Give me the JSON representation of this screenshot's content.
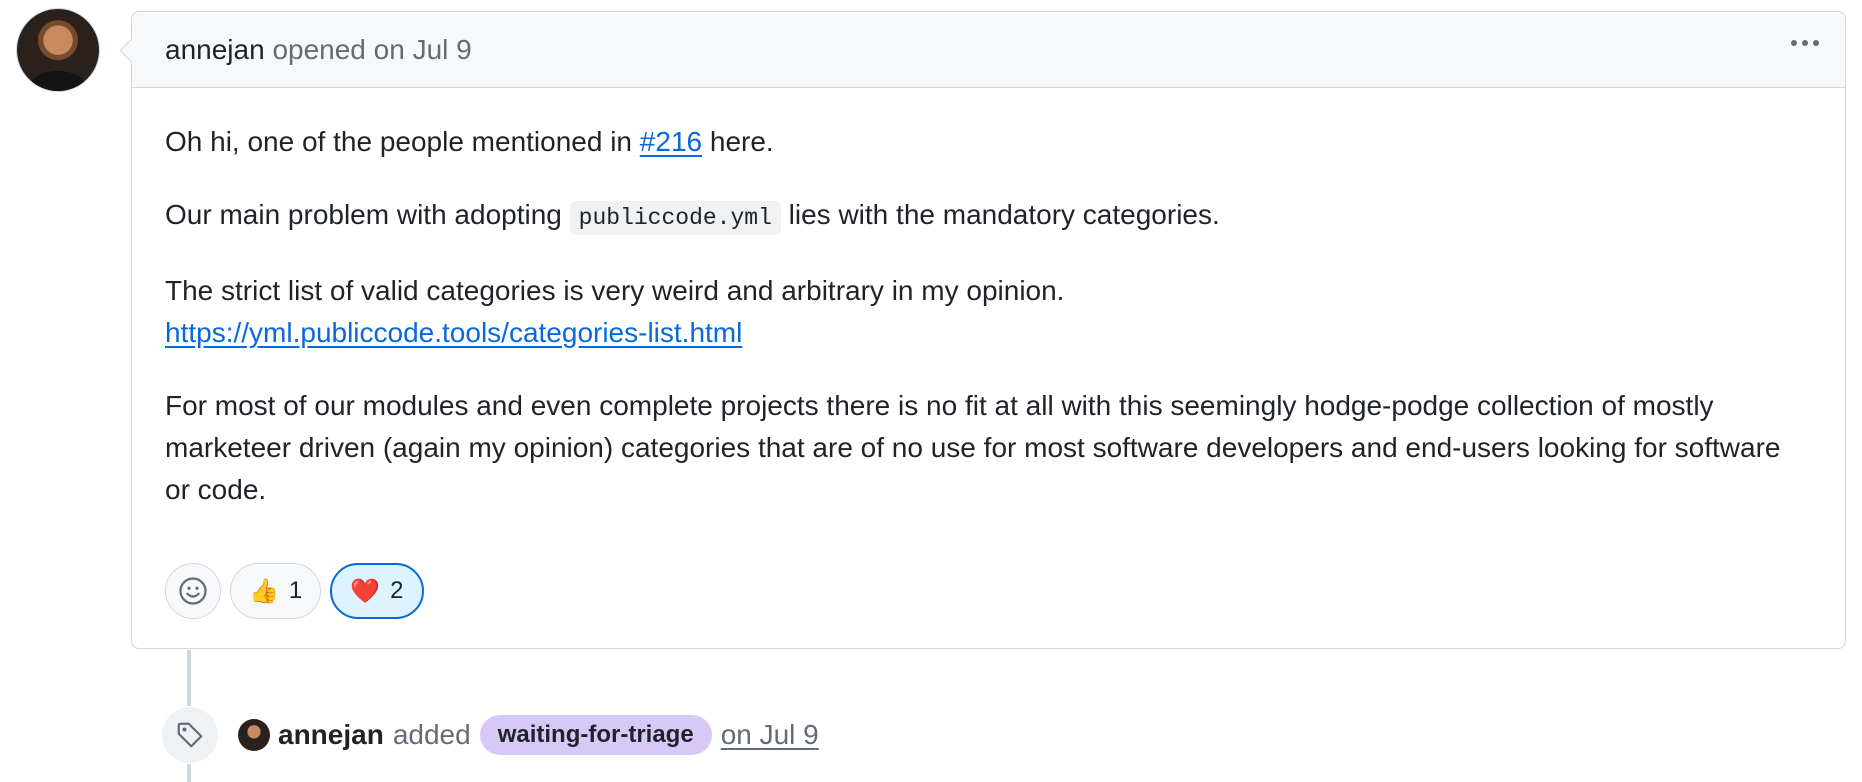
{
  "comment": {
    "author": "annejan",
    "action_text": "opened on Jul 9",
    "body": {
      "p1_before": "Oh hi, one of the people mentioned in ",
      "p1_link": "#216",
      "p1_after": " here.",
      "p2_before": "Our main problem with adopting ",
      "p2_code": "publiccode.yml",
      "p2_after": " lies with the mandatory categories.",
      "p3_text": "The strict list of valid categories is very weird and arbitrary in my opinion.",
      "p3_link": "https://yml.publiccode.tools/categories-list.html",
      "p4_text": "For most of our modules and even complete projects there is no fit at all with this seemingly hodge-podge collection of mostly marketeer driven (again my opinion) categories that are of no use for most software developers and end-users looking for software or code."
    },
    "reactions": [
      {
        "emoji": "👍",
        "count": "1",
        "active": false
      },
      {
        "emoji": "❤️",
        "count": "2",
        "active": true
      }
    ]
  },
  "event": {
    "actor": "annejan",
    "verb": "added",
    "label": "waiting-for-triage",
    "label_color": "#d8c8f8",
    "date": "on Jul 9"
  },
  "icons": [
    "avatar",
    "kebab-icon",
    "smiley-icon",
    "tag-icon"
  ],
  "colors": {
    "link": "#0969da",
    "muted": "#636c76",
    "border": "#d0d7de",
    "active_reaction_bg": "#ddf4ff"
  }
}
